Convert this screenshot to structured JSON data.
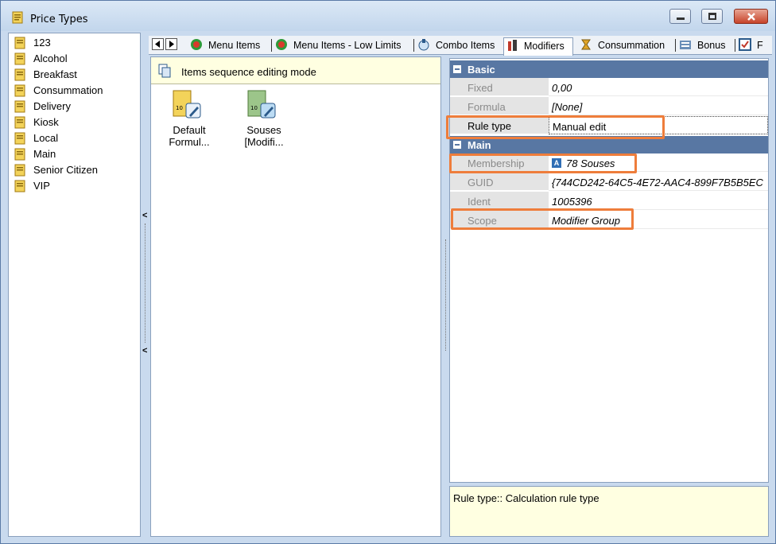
{
  "window": {
    "title": "Price Types"
  },
  "price_types": [
    {
      "label": "123"
    },
    {
      "label": "Alcohol"
    },
    {
      "label": "Breakfast"
    },
    {
      "label": "Consummation"
    },
    {
      "label": "Delivery"
    },
    {
      "label": "Kiosk"
    },
    {
      "label": "Local"
    },
    {
      "label": "Main"
    },
    {
      "label": "Senior Citizen"
    },
    {
      "label": "VIP"
    }
  ],
  "tabs": [
    {
      "label": "Menu Items",
      "icon": "menu-items-icon"
    },
    {
      "label": "Menu Items - Low Limits",
      "icon": "menu-items-low-limits-icon"
    },
    {
      "label": "Combo Items",
      "icon": "combo-items-icon"
    },
    {
      "label": "Modifiers",
      "icon": "modifiers-icon",
      "active": true
    },
    {
      "label": "Consummation",
      "icon": "consummation-icon"
    },
    {
      "label": "Bonus",
      "icon": "bonus-icon"
    },
    {
      "label": "F",
      "icon": "f-tab-icon"
    }
  ],
  "middle": {
    "banner": "Items sequence editing mode",
    "items": [
      {
        "label_line1": "Default",
        "label_line2": "Formul..."
      },
      {
        "label_line1": "Souses",
        "label_line2": "[Modifi..."
      }
    ]
  },
  "properties": {
    "basic": {
      "title": "Basic",
      "rows": [
        {
          "name": "Fixed",
          "value": "0,00"
        },
        {
          "name": "Formula",
          "value": "[None]"
        },
        {
          "name": "Rule type",
          "value": "Manual edit"
        }
      ]
    },
    "main": {
      "title": "Main",
      "rows": [
        {
          "name": "Membership",
          "value": "78 Souses"
        },
        {
          "name": "GUID",
          "value": "{744CD242-64C5-4E72-AAC4-899F7B5B5EC"
        },
        {
          "name": "Ident",
          "value": "1005396"
        },
        {
          "name": "Scope",
          "value": "Modifier Group"
        }
      ]
    }
  },
  "description": "Rule type:: Calculation rule type",
  "colors": {
    "highlight": "#ee7d3b",
    "category_bg": "#5877a3",
    "info_bg": "#ffffe1"
  }
}
